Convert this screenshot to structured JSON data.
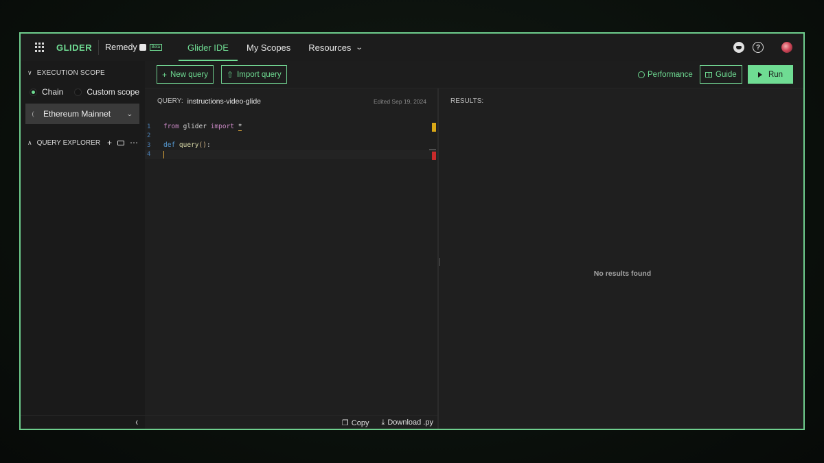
{
  "nav": {
    "logo": "GLIDER",
    "remedy": "Remedy",
    "beta": "Beta",
    "tabs": [
      {
        "label": "Glider IDE"
      },
      {
        "label": "My Scopes"
      },
      {
        "label": "Resources"
      }
    ],
    "icons": [
      "discord-icon",
      "help-icon",
      "avatar"
    ],
    "help_glyph": "?"
  },
  "sidebar": {
    "execution_scope": "EXECUTION SCOPE",
    "chain_option": "Chain",
    "custom_option": "Custom scope",
    "selected_scope": "Chain",
    "chain_select": "Ethereum Mainnet",
    "query_explorer": "QUERY EXPLORER",
    "add_glyph": "+",
    "more_glyph": "⋯"
  },
  "toolbar": {
    "new_query": "New query",
    "import_query": "Import query",
    "performance": "Performance",
    "guide": "Guide",
    "run": "Run"
  },
  "editor": {
    "query_label": "QUERY:",
    "query_name": "instructions-video-glide",
    "edited": "Edited Sep 19, 2024",
    "line_numbers": [
      "1",
      "2",
      "3",
      "4"
    ],
    "code": {
      "l1_from": "from",
      "l1_mod": "glider",
      "l1_import": "import",
      "l1_star": "*",
      "l3_def": "def",
      "l3_fn": "query",
      "l3_paren": "()",
      "l3_colon": ":"
    },
    "copy": "Copy",
    "download": "Download .py"
  },
  "results": {
    "label": "RESULTS:",
    "empty": "No results found"
  },
  "colors": {
    "accent": "#6fdc93",
    "frame_border": "#6fcf8e",
    "warning_marker": "#d9a817",
    "error_marker": "#c92a2a"
  }
}
